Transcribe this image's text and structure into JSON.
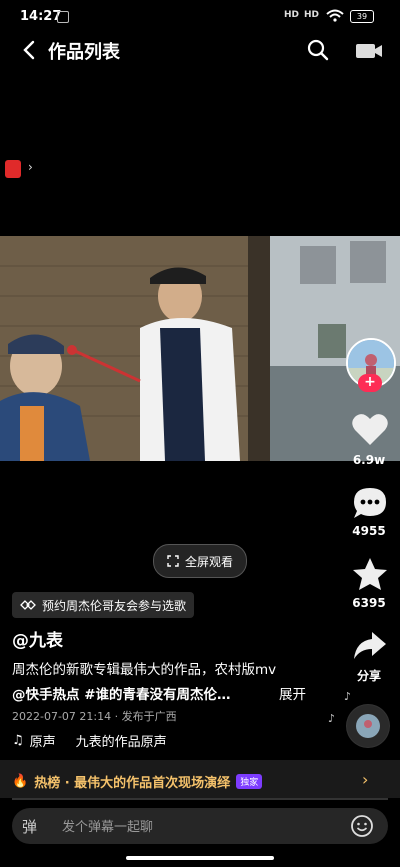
{
  "status": {
    "time": "14:27",
    "battery": "39",
    "signal": [
      "HD",
      "HD"
    ]
  },
  "header": {
    "title": "作品列表"
  },
  "actions": {
    "likes": "6.9w",
    "comments": "4955",
    "favorites": "6395",
    "share": "分享"
  },
  "fullscreen_label": "全屏观看",
  "promo_label": "预约周杰伦哥友会参与选歌",
  "author": "@九表",
  "description": {
    "line1": "周杰伦的新歌专辑最伟大的作品，农村版mv",
    "line2": "@快手热点 #谁的青春没有周杰伦…",
    "more": "展开"
  },
  "meta": "2022-07-07 21:14 · 发布于广西",
  "music": {
    "prefix": "原声",
    "name": "九表的作品原声"
  },
  "hot": {
    "text": "热榜 · 最伟大的作品首次现场演绎",
    "badge": "独家"
  },
  "comment": {
    "placeholder": "发个弹幕一起聊",
    "danmu": "弹"
  },
  "progress": 0.0,
  "colors": {
    "accent": "#fe2c55",
    "hot": "#f5c26b"
  }
}
